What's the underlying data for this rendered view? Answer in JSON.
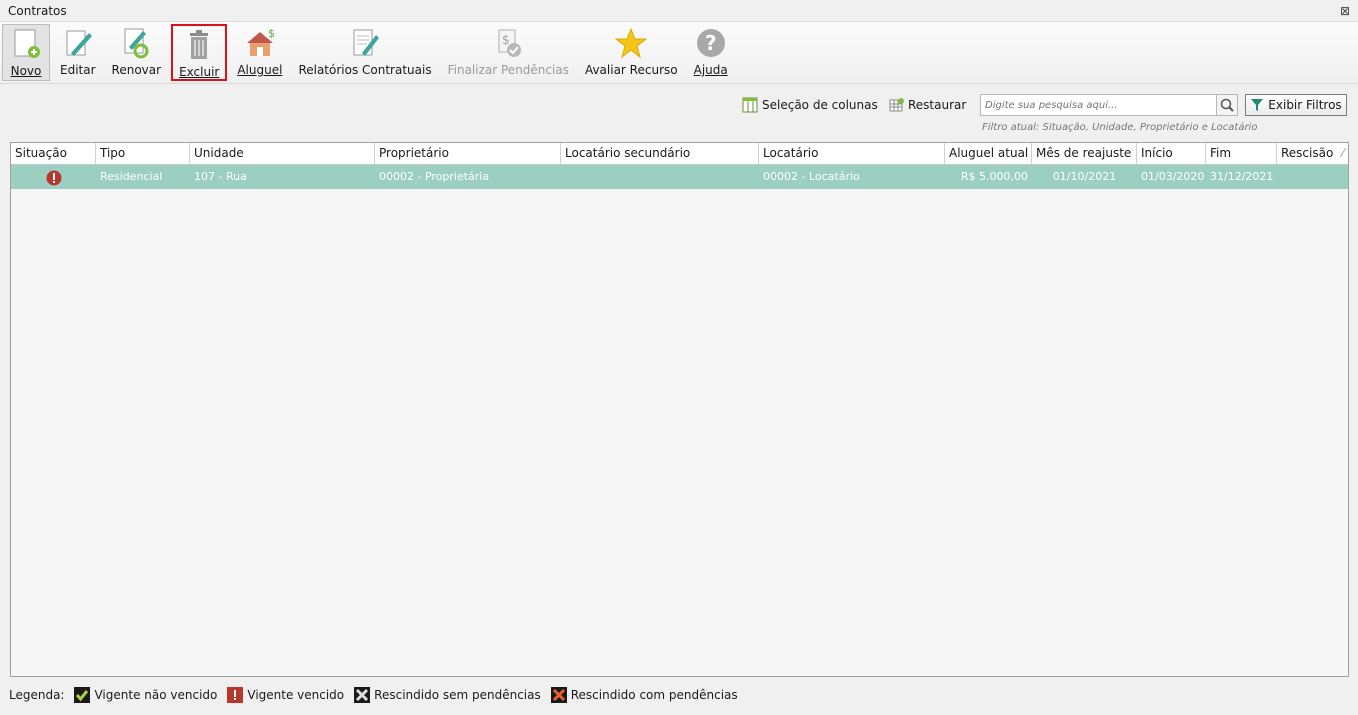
{
  "window": {
    "title": "Contratos",
    "close": "⊠"
  },
  "toolbar": {
    "items": [
      {
        "label": "Novo"
      },
      {
        "label": "Editar"
      },
      {
        "label": "Renovar"
      },
      {
        "label": "Excluir"
      },
      {
        "label": "Aluguel"
      },
      {
        "label": "Relatórios Contratuais"
      },
      {
        "label": "Finalizar Pendências"
      },
      {
        "label": "Avaliar Recurso"
      },
      {
        "label": "Ajuda"
      }
    ]
  },
  "actions": {
    "columns_label": "Seleção de colunas",
    "restore_label": "Restaurar",
    "search_placeholder": "Digite sua pesquisa aqui...",
    "filters_label": "Exibir Filtros",
    "current_filter": "Filtro atual: Situação, Unidade, Proprietário e Locatário"
  },
  "table": {
    "columns": [
      "Situação",
      "Tipo",
      "Unidade",
      "Proprietário",
      "Locatário secundário",
      "Locatário",
      "Aluguel atual",
      "Mês de reajuste",
      "Início",
      "Fim",
      "Rescisão"
    ],
    "rows": [
      {
        "situacao_icon": "warning-icon",
        "tipo": "Residencial",
        "unidade": "107 - Rua",
        "proprietario": "00002 - Proprietária",
        "locatario_secundario": "",
        "locatario": "00002 - Locatário",
        "aluguel": "R$ 5.000,00",
        "mes_reajuste": "01/10/2021",
        "inicio": "01/03/2020",
        "fim": "31/12/2021",
        "rescisao": ""
      }
    ]
  },
  "legend": {
    "title": "Legenda:",
    "items": [
      "Vigente não vencido",
      "Vigente vencido",
      "Rescindido sem pendências",
      "Rescindido com pendências"
    ]
  },
  "colors": {
    "selected_row": "#9acfc1",
    "highlight": "#e0101a",
    "status_warning": "#c0392b"
  }
}
